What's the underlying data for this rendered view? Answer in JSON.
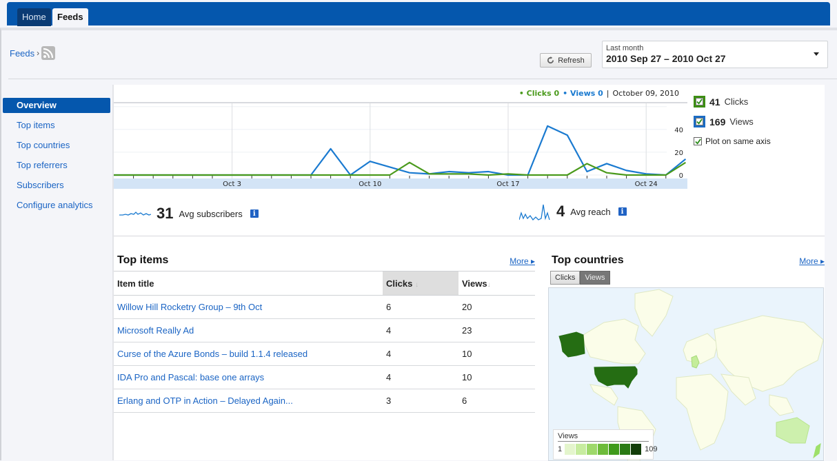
{
  "nav": {
    "tabs": [
      {
        "label": "Home",
        "active": false
      },
      {
        "label": "Feeds",
        "active": true
      }
    ]
  },
  "breadcrumb": {
    "root": "Feeds",
    "separator": "›",
    "icon": "rss-icon"
  },
  "toolbar": {
    "refresh_label": "Refresh",
    "date_range": {
      "preset": "Last month",
      "value": "2010 Sep 27 – 2010 Oct 27"
    }
  },
  "sidebar": {
    "items": [
      {
        "label": "Overview",
        "active": true
      },
      {
        "label": "Top items",
        "active": false
      },
      {
        "label": "Top countries",
        "active": false
      },
      {
        "label": "Top referrers",
        "active": false
      },
      {
        "label": "Subscribers",
        "active": false
      },
      {
        "label": "Configure analytics",
        "active": false
      }
    ]
  },
  "chart_legend": {
    "clicks": "• Clicks 0",
    "views": "• Views 0",
    "separator": "|",
    "date": "October 09, 2010"
  },
  "series_toggles": [
    {
      "count": "41",
      "name": "Clicks",
      "checked": true,
      "color": "#3d8f13"
    },
    {
      "count": "169",
      "name": "Views",
      "checked": true,
      "color": "#1c6cc4"
    }
  ],
  "plot_same_axis": {
    "label": "Plot on same axis",
    "checked": true
  },
  "chart_data": {
    "type": "line",
    "title": "",
    "xlabel": "",
    "ylabel": "",
    "x": [
      "Sep 27",
      "Sep 28",
      "Sep 29",
      "Sep 30",
      "Oct 1",
      "Oct 2",
      "Oct 3",
      "Oct 4",
      "Oct 5",
      "Oct 6",
      "Oct 7",
      "Oct 8",
      "Oct 9",
      "Oct 10",
      "Oct 11",
      "Oct 12",
      "Oct 13",
      "Oct 14",
      "Oct 15",
      "Oct 16",
      "Oct 17",
      "Oct 18",
      "Oct 19",
      "Oct 20",
      "Oct 21",
      "Oct 22",
      "Oct 23",
      "Oct 24",
      "Oct 25"
    ],
    "x_tick_labels": [
      "Oct 3",
      "Oct 10",
      "Oct 17",
      "Oct 24"
    ],
    "y_tick_labels": [
      "0",
      "20",
      "40"
    ],
    "ylim": [
      -4,
      58
    ],
    "y_axis_position": "right",
    "grid": true,
    "series": [
      {
        "name": "Clicks",
        "color": "#4a9a1c",
        "values": [
          0,
          0,
          0,
          0,
          0,
          0,
          0,
          0,
          0,
          0,
          0,
          0,
          0,
          0,
          0,
          11,
          1,
          1,
          1,
          0,
          1,
          0,
          0,
          0,
          10,
          2,
          0,
          0,
          0,
          11
        ]
      },
      {
        "name": "Views",
        "color": "#1a7ad0",
        "values": [
          0,
          0,
          0,
          0,
          0,
          0,
          0,
          0,
          0,
          0,
          0,
          23,
          0,
          12,
          7,
          2,
          1,
          3,
          2,
          3,
          0,
          0,
          43,
          35,
          3,
          10,
          4,
          1,
          0,
          14
        ]
      }
    ]
  },
  "summary": {
    "subscribers": {
      "value": "31",
      "label": "Avg subscribers"
    },
    "reach": {
      "value": "4",
      "label": "Avg reach"
    }
  },
  "top_items": {
    "title": "Top items",
    "more": "More ▸",
    "columns": [
      "Item title",
      "Clicks",
      "Views"
    ],
    "sorted_column": "Clicks",
    "rows": [
      {
        "title": "Willow Hill Rocketry Group – 9th Oct",
        "clicks": "6",
        "views": "20"
      },
      {
        "title": "Microsoft Really Ad",
        "clicks": "4",
        "views": "23"
      },
      {
        "title": "Curse of the Azure Bonds – build 1.1.4 released",
        "clicks": "4",
        "views": "10"
      },
      {
        "title": "IDA Pro and Pascal: base one arrays",
        "clicks": "4",
        "views": "10"
      },
      {
        "title": "Erlang and OTP in Action – Delayed Again...",
        "clicks": "3",
        "views": "6"
      }
    ]
  },
  "top_countries": {
    "title": "Top countries",
    "more": "More ▸",
    "toggle": [
      "Clicks",
      "Views"
    ],
    "selected": "Views",
    "legend": {
      "title": "Views",
      "min": "1",
      "max": "109",
      "colors": [
        "#e4f5cc",
        "#c7ec9f",
        "#9ed86a",
        "#6dbb3a",
        "#3f9a1b",
        "#2a7a14",
        "#123d08"
      ]
    }
  }
}
